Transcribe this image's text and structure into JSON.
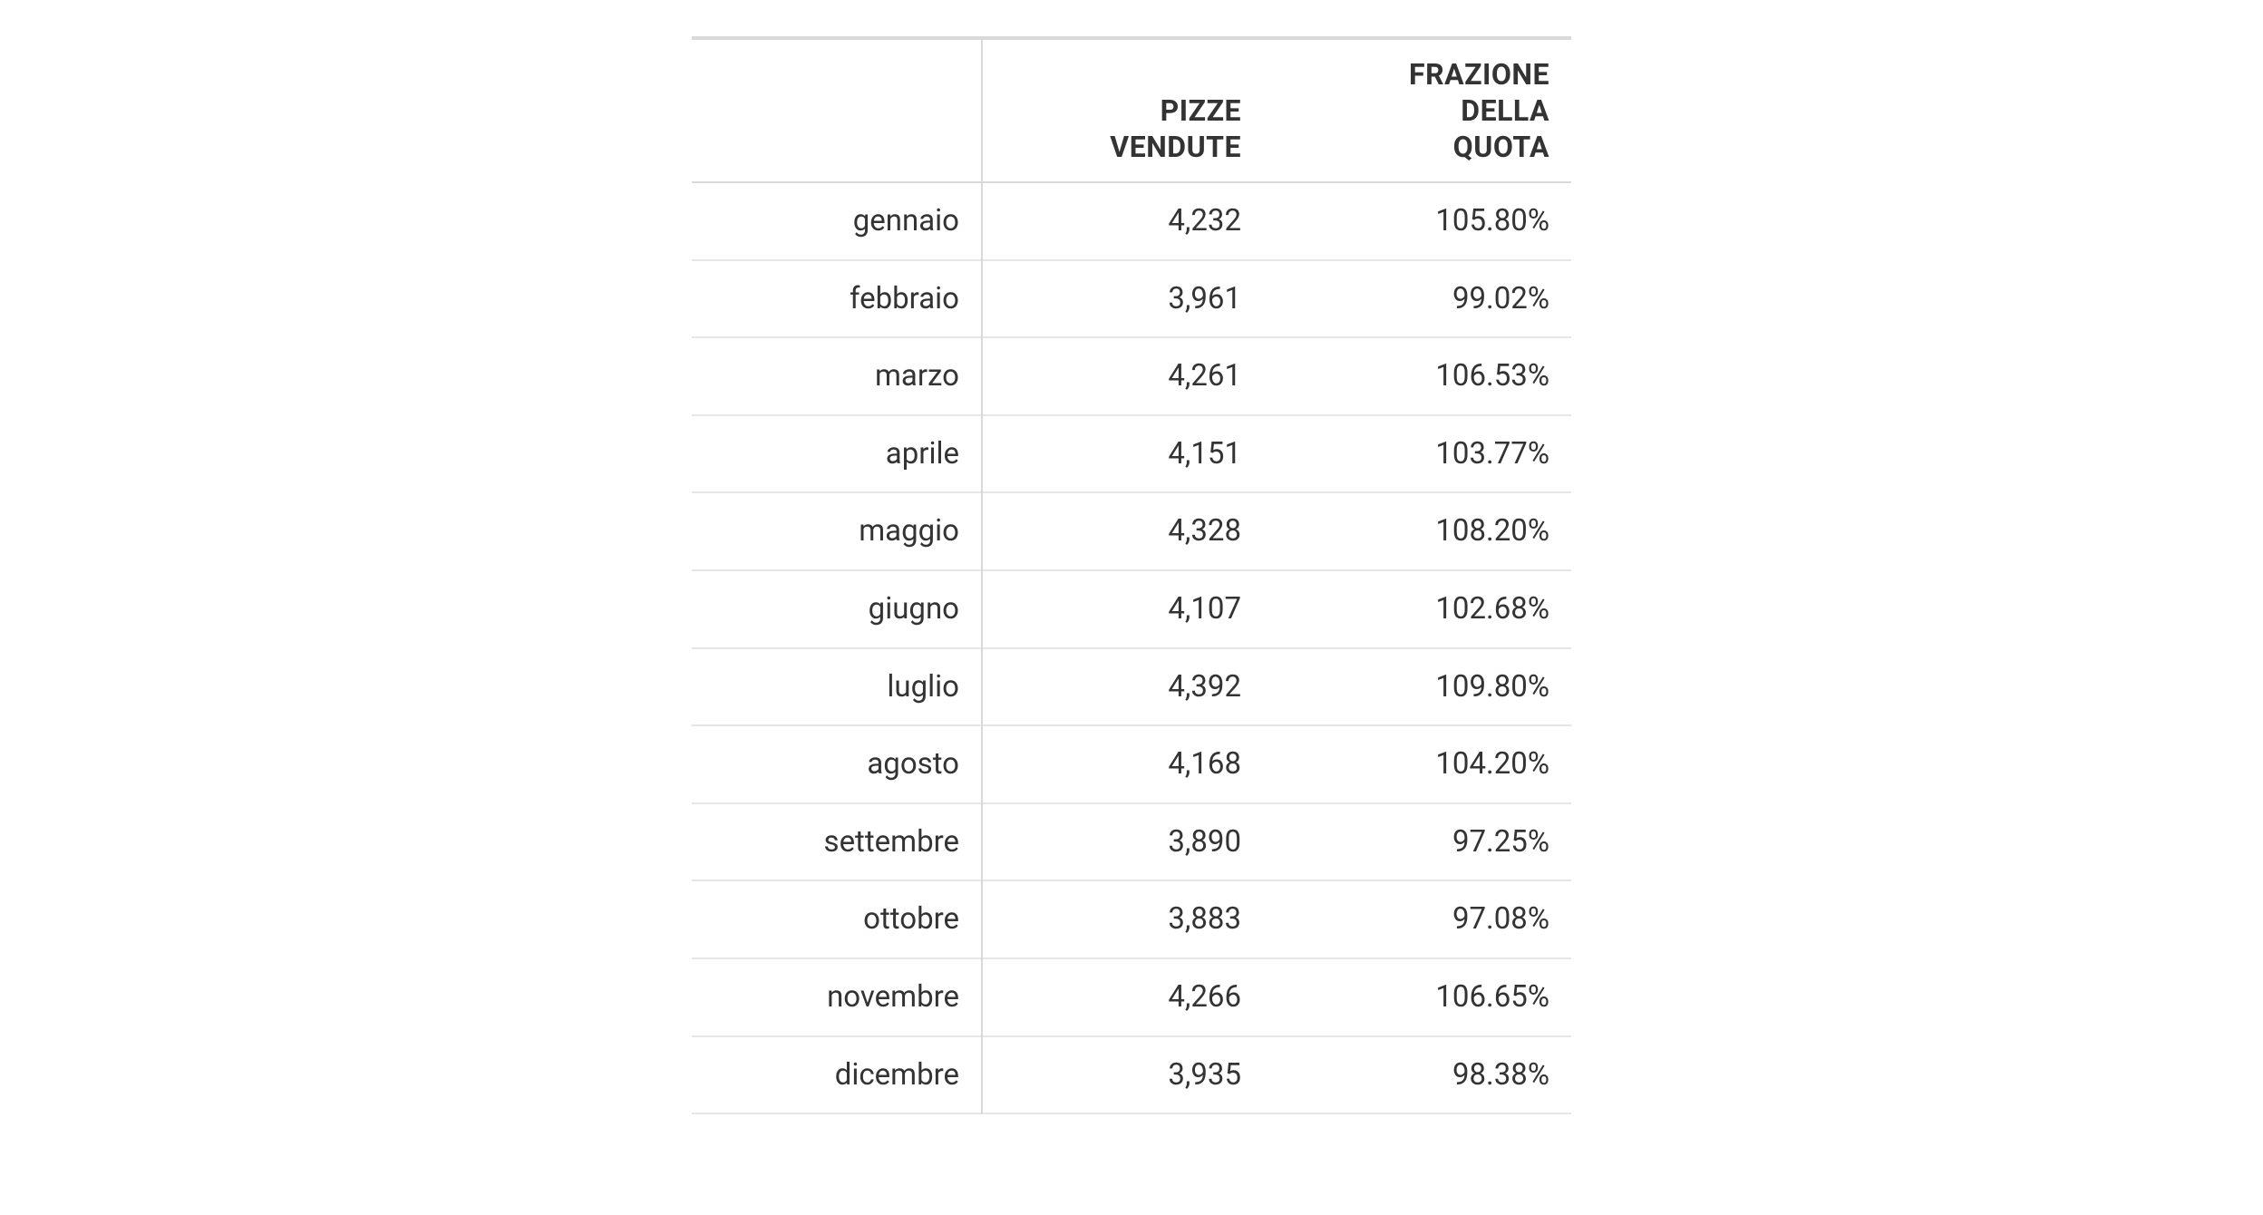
{
  "chart_data": {
    "type": "table",
    "columns": [
      "",
      "PIZZE VENDUTE",
      "FRAZIONE DELLA QUOTA"
    ],
    "rows": [
      {
        "month": "gennaio",
        "sold": "4,232",
        "fraction": "105.80%"
      },
      {
        "month": "febbraio",
        "sold": "3,961",
        "fraction": "99.02%"
      },
      {
        "month": "marzo",
        "sold": "4,261",
        "fraction": "106.53%"
      },
      {
        "month": "aprile",
        "sold": "4,151",
        "fraction": "103.77%"
      },
      {
        "month": "maggio",
        "sold": "4,328",
        "fraction": "108.20%"
      },
      {
        "month": "giugno",
        "sold": "4,107",
        "fraction": "102.68%"
      },
      {
        "month": "luglio",
        "sold": "4,392",
        "fraction": "109.80%"
      },
      {
        "month": "agosto",
        "sold": "4,168",
        "fraction": "104.20%"
      },
      {
        "month": "settembre",
        "sold": "3,890",
        "fraction": "97.25%"
      },
      {
        "month": "ottobre",
        "sold": "3,883",
        "fraction": "97.08%"
      },
      {
        "month": "novembre",
        "sold": "4,266",
        "fraction": "106.65%"
      },
      {
        "month": "dicembre",
        "sold": "3,935",
        "fraction": "98.38%"
      }
    ]
  },
  "headers": {
    "month": "",
    "sold_line1": "PIZZE",
    "sold_line2": "VENDUTE",
    "fraction_line1": "FRAZIONE",
    "fraction_line2": "DELLA",
    "fraction_line3": "QUOTA"
  }
}
